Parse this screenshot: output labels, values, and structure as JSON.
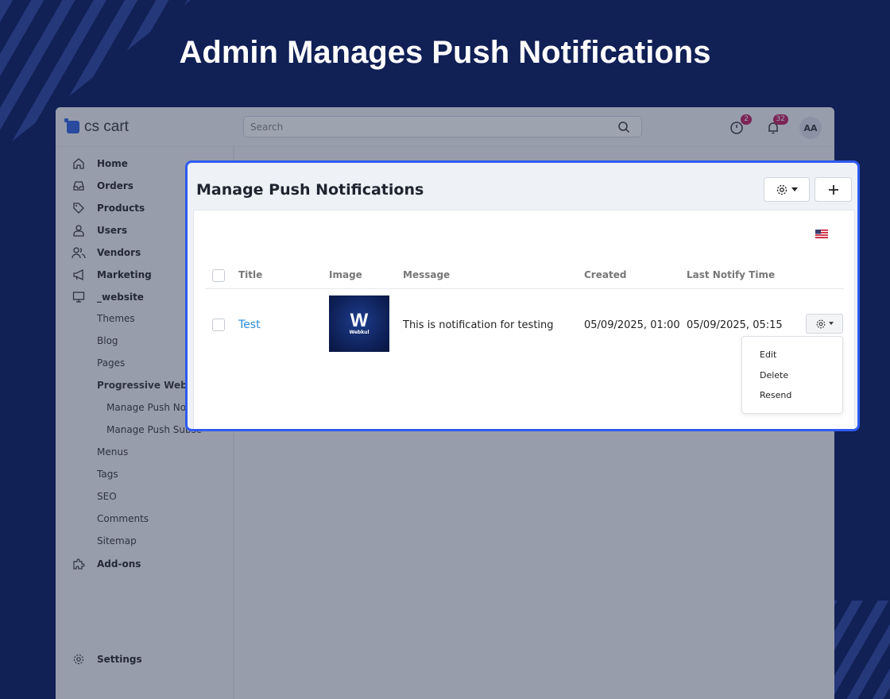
{
  "headline": "Admin Manages Push Notifications",
  "app": {
    "logo_text": "cs cart",
    "search_placeholder": "Search",
    "badges": {
      "orders_count": "2",
      "notifications_count": "32"
    },
    "avatar_initials": "AA",
    "colors": {
      "accent": "#2f5bf0",
      "badge": "#c2185b",
      "link": "#2a8bd6",
      "background": "#112055"
    }
  },
  "sidebar": {
    "items": [
      {
        "label": "Home",
        "icon": "home-icon"
      },
      {
        "label": "Orders",
        "icon": "inbox-icon"
      },
      {
        "label": "Products",
        "icon": "tag-icon"
      },
      {
        "label": "Users",
        "icon": "user-icon"
      },
      {
        "label": "Vendors",
        "icon": "users-icon"
      },
      {
        "label": "Marketing",
        "icon": "megaphone-icon"
      },
      {
        "label": "_website",
        "icon": "monitor-icon"
      }
    ],
    "website_subitems": [
      "Themes",
      "Blog",
      "Pages",
      "Progressive Web Ap"
    ],
    "pwa_subitems": [
      "Manage Push Notif",
      "Manage Push Subscri"
    ],
    "more_subitems": [
      "Menus",
      "Tags",
      "SEO",
      "Comments",
      "Sitemap"
    ],
    "addons": {
      "label": "Add-ons",
      "icon": "puzzle-icon"
    },
    "settings": {
      "label": "Settings",
      "icon": "gear-icon"
    }
  },
  "panel": {
    "title": "Manage Push Notifications",
    "columns": [
      "Title",
      "Image",
      "Message",
      "Created",
      "Last Notify Time"
    ],
    "rows": [
      {
        "title": "Test",
        "image_brand": "W",
        "image_caption": "Webkul",
        "message": "This is notification for testing",
        "created": "05/09/2025, 01:00",
        "last_notify_time": "05/09/2025, 05:15"
      }
    ],
    "row_actions": [
      "Edit",
      "Delete",
      "Resend"
    ]
  }
}
